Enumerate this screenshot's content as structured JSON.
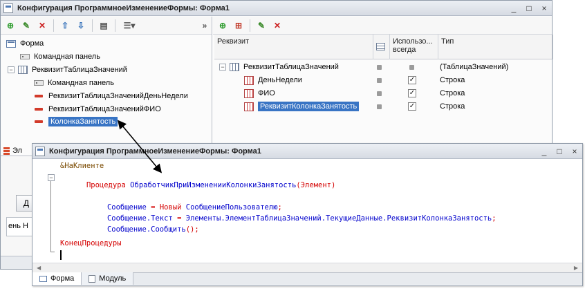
{
  "back_window": {
    "title": "Конфигурация ПрограммноеИзменениеФормы: Форма1",
    "controls": [
      "_",
      "□",
      "×"
    ],
    "left_tree": [
      {
        "label": "Форма",
        "icon": "form-icon"
      },
      {
        "label": "Командная панель",
        "icon": "command-panel-icon"
      },
      {
        "label": "РеквизитТаблицаЗначений",
        "icon": "value-table-icon",
        "expander": "−"
      },
      {
        "label": "Командная панель",
        "icon": "command-panel-icon"
      },
      {
        "label": "РеквизитТаблицаЗначенийДеньНедели",
        "icon": "field-icon"
      },
      {
        "label": "РеквизитТаблицаЗначенийФИО",
        "icon": "field-icon"
      },
      {
        "label": "КолонкаЗанятость",
        "icon": "field-icon",
        "selected": true
      }
    ],
    "attr_columns": {
      "name": "Реквизит",
      "always_use": "Использо... всегда",
      "type": "Тип"
    },
    "attr_rows": [
      {
        "name": "РеквизитТаблицаЗначений",
        "always": false,
        "type": "(ТаблицаЗначений)",
        "expander": "−"
      },
      {
        "name": "ДеньНедели",
        "always": true,
        "type": "Строка"
      },
      {
        "name": "ФИО",
        "always": true,
        "type": "Строка"
      },
      {
        "name": "РеквизитКолонкаЗанятость",
        "always": true,
        "type": "Строка",
        "selected": true
      }
    ],
    "left_tab_partial": "Эл",
    "fragment_button": "Д",
    "fragment_text": "ень Н",
    "fragment_tab": "Ф"
  },
  "front_window": {
    "title": "Конфигурация ПрограммноеИзменениеФормы: Форма1",
    "controls": [
      "_",
      "□",
      "×"
    ],
    "code": {
      "directive": "&НаКлиенте",
      "proc_kw": "Процедура",
      "proc_name": "ОбработчикПриИзмененииКолонкиЗанятость",
      "proc_params": "(Элемент)",
      "l1_a": "Сообщение",
      "l1_eq": "=",
      "l1_new": "Новый",
      "l1_type": "СообщениеПользователю",
      "l1_end": ";",
      "l2_a": "Сообщение.Текст",
      "l2_eq": "=",
      "l2_b": "Элементы.ЭлементТаблицаЗначений.ТекущиеДанные.РеквизитКолонкаЗанятость",
      "l2_end": ";",
      "l3": "Сообщение.Сообщить",
      "l3_end": "();",
      "end_kw": "КонецПроцедуры"
    },
    "tabs": [
      {
        "label": "Форма",
        "active": true
      },
      {
        "label": "Модуль",
        "active": false
      }
    ]
  },
  "colors": {
    "keyword": "#d40000",
    "identifier": "#0000cc",
    "selection": "#3874c4"
  }
}
